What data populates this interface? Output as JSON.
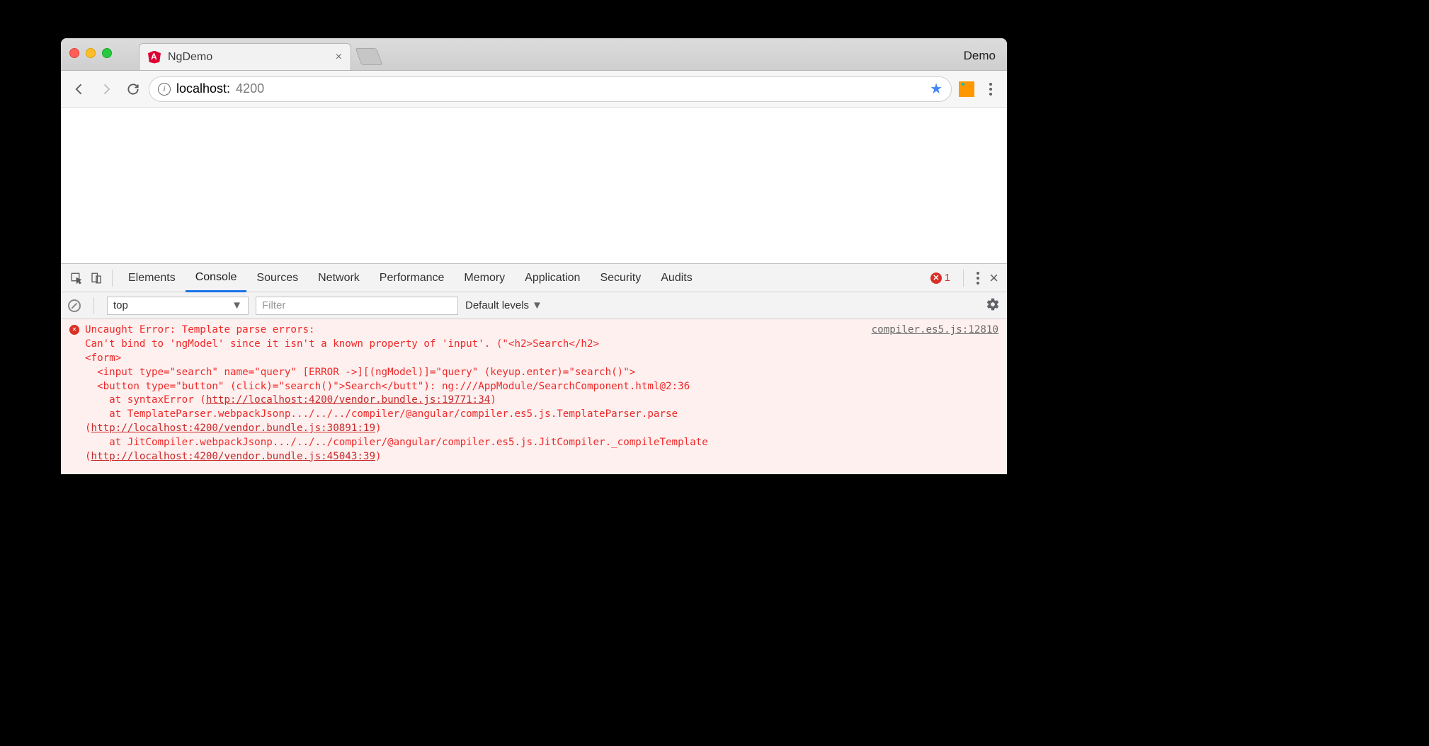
{
  "chrome": {
    "tab_title": "NgDemo",
    "right_label": "Demo",
    "url_host": "localhost:",
    "url_port": "4200"
  },
  "devtools": {
    "tabs": [
      "Elements",
      "Console",
      "Sources",
      "Network",
      "Performance",
      "Memory",
      "Application",
      "Security",
      "Audits"
    ],
    "active_tab": "Console",
    "error_count": "1"
  },
  "console_toolbar": {
    "context": "top",
    "filter_placeholder": "Filter",
    "levels": "Default levels"
  },
  "error": {
    "source": "compiler.es5.js:12810",
    "line1": "Uncaught Error: Template parse errors:",
    "line2": "Can't bind to 'ngModel' since it isn't a known property of 'input'. (\"<h2>Search</h2>",
    "line3": "<form>",
    "line4": "  <input type=\"search\" name=\"query\" [ERROR ->][(ngModel)]=\"query\" (keyup.enter)=\"search()\">",
    "line5": "  <button type=\"button\" (click)=\"search()\">Search</butt\"): ng:///AppModule/SearchComponent.html@2:36",
    "stack1_pre": "    at syntaxError (",
    "stack1_link": "http://localhost:4200/vendor.bundle.js:19771:34",
    "stack2_pre": "    at TemplateParser.webpackJsonp.../../../compiler/@angular/compiler.es5.js.TemplateParser.parse (",
    "stack2_link": "http://localhost:4200/vendor.bundle.js:30891:19",
    "stack3_pre": "    at JitCompiler.webpackJsonp.../../../compiler/@angular/compiler.es5.js.JitCompiler._compileTemplate (",
    "stack3_link": "http://localhost:4200/vendor.bundle.js:45043:39"
  }
}
